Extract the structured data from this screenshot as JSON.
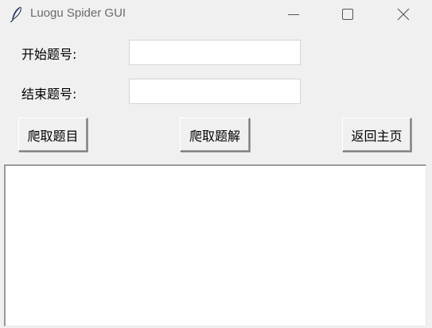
{
  "window": {
    "title": "Luogu Spider GUI",
    "icon": "feather-icon",
    "controls": {
      "minimize": "minimize-icon",
      "maximize": "maximize-icon",
      "close": "close-icon"
    }
  },
  "form": {
    "start_label": "开始题号:",
    "start_value": "",
    "end_label": "结束题号:",
    "end_value": ""
  },
  "buttons": {
    "crawl_problems": "爬取题目",
    "crawl_solutions": "爬取题解",
    "back_home": "返回主页"
  },
  "output": {
    "text": ""
  }
}
